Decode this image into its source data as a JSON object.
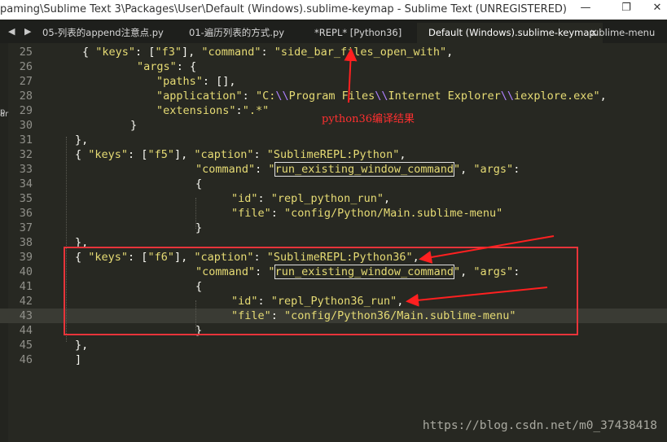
{
  "window": {
    "title": "paming\\Sublime Text 3\\Packages\\User\\Default (Windows).sublime-keymap - Sublime Text (UNREGISTERED)",
    "minimize_glyph": "—",
    "restore_glyph": "❐",
    "close_glyph": "✕"
  },
  "tabs": [
    {
      "label": "05-列表的append注意点.py"
    },
    {
      "label": "01-遍历列表的方式.py"
    },
    {
      "label": "*REPL* [Python36]"
    },
    {
      "label": "Default (Windows).sublime-keymap",
      "active": true,
      "close": "×"
    },
    {
      "label": "ublime-menu"
    }
  ],
  "nav": {
    "arrows": "◀ ▶"
  },
  "left_clipped": [
    "p",
    "ar"
  ],
  "lines": [
    {
      "n": "25",
      "t": "{ \"keys\": [\"f3\"], \"command\": \"side_bar_files_open_with\","
    },
    {
      "n": "26",
      "t": "\"args\": {"
    },
    {
      "n": "27",
      "t": "\"paths\": [],"
    },
    {
      "n": "28",
      "t": "\"application\": \"C:\\\\Program Files\\\\Internet Explorer\\\\iexplore.exe\","
    },
    {
      "n": "29",
      "t": "\"extensions\":\".*\""
    },
    {
      "n": "30",
      "t": "}"
    },
    {
      "n": "31",
      "t": "},"
    },
    {
      "n": "32",
      "t": "{ \"keys\": [\"f5\"], \"caption\": \"SublimeREPL:Python\","
    },
    {
      "n": "33",
      "t": "\"command\": \"run_existing_window_command\", \"args\":"
    },
    {
      "n": "34",
      "t": "{"
    },
    {
      "n": "35",
      "t": "\"id\": \"repl_python_run\","
    },
    {
      "n": "36",
      "t": "\"file\": \"config/Python/Main.sublime-menu\""
    },
    {
      "n": "37",
      "t": "}"
    },
    {
      "n": "38",
      "t": "},"
    },
    {
      "n": "39",
      "t": "{ \"keys\": [\"f6\"], \"caption\": \"SublimeREPL:Python36\","
    },
    {
      "n": "40",
      "t": "\"command\": \"run_existing_window_command\", \"args\":"
    },
    {
      "n": "41",
      "t": "{"
    },
    {
      "n": "42",
      "t": "\"id\": \"repl_Python36_run\","
    },
    {
      "n": "43",
      "t": "\"file\": \"config/Python36/Main.sublime-menu\""
    },
    {
      "n": "44",
      "t": "}"
    },
    {
      "n": "45",
      "t": "},"
    },
    {
      "n": "46",
      "t": "]"
    }
  ],
  "annotation": "python36编译结果",
  "watermark": "https://blog.csdn.net/m0_37438418",
  "colors": {
    "background": "#272822",
    "string": "#e6db74",
    "escape": "#ae81ff",
    "annotation_red": "#e8343a"
  }
}
